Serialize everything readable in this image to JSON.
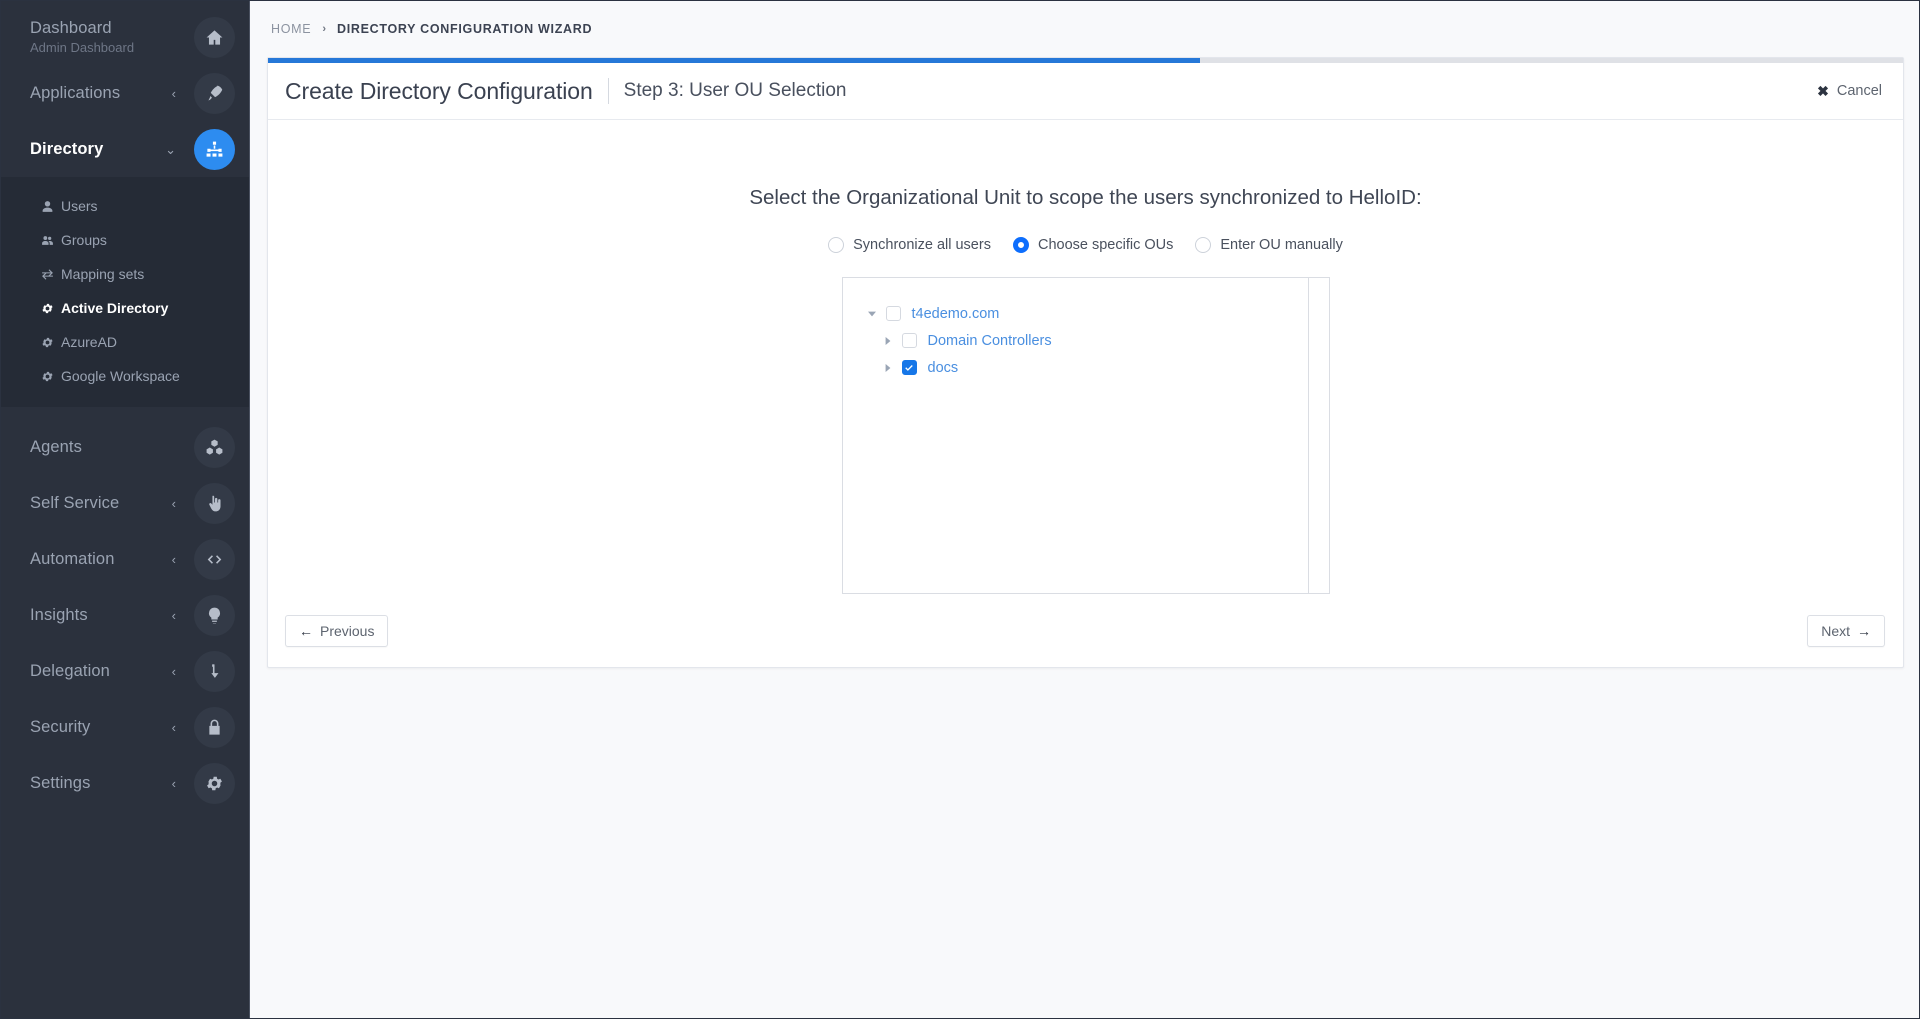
{
  "sidebar": {
    "top_items": [
      {
        "label": "Dashboard",
        "sublabel": "Admin Dashboard",
        "icon": "home-icon",
        "caret": "",
        "active": false
      },
      {
        "label": "Applications",
        "sublabel": "",
        "icon": "rocket-icon",
        "caret": "‹",
        "active": false
      },
      {
        "label": "Directory",
        "sublabel": "",
        "icon": "sitemap-icon",
        "caret": "⌄",
        "active": true
      }
    ],
    "sub_items": [
      {
        "label": "Users",
        "icon": "user-icon",
        "active": false
      },
      {
        "label": "Groups",
        "icon": "users-icon",
        "active": false
      },
      {
        "label": "Mapping sets",
        "icon": "exchange-icon",
        "active": false
      },
      {
        "label": "Active Directory",
        "icon": "gear-icon",
        "active": true
      },
      {
        "label": "AzureAD",
        "icon": "gear-icon",
        "active": false
      },
      {
        "label": "Google Workspace",
        "icon": "gear-icon",
        "active": false
      }
    ],
    "bottom_items": [
      {
        "label": "Agents",
        "sublabel": "",
        "icon": "cubes-icon",
        "caret": "",
        "active": false
      },
      {
        "label": "Self Service",
        "sublabel": "",
        "icon": "hand-pointer-icon",
        "caret": "‹",
        "active": false
      },
      {
        "label": "Automation",
        "sublabel": "",
        "icon": "code-icon",
        "caret": "‹",
        "active": false
      },
      {
        "label": "Insights",
        "sublabel": "",
        "icon": "lightbulb-icon",
        "caret": "‹",
        "active": false
      },
      {
        "label": "Delegation",
        "sublabel": "",
        "icon": "level-down-icon",
        "caret": "‹",
        "active": false
      },
      {
        "label": "Security",
        "sublabel": "",
        "icon": "lock-icon",
        "caret": "‹",
        "active": false
      },
      {
        "label": "Settings",
        "sublabel": "",
        "icon": "gear-icon",
        "caret": "‹",
        "active": false
      }
    ]
  },
  "breadcrumb": {
    "home": "HOME",
    "separator": "›",
    "current": "DIRECTORY CONFIGURATION WIZARD"
  },
  "wizard": {
    "progress_percent": 57,
    "title": "Create Directory Configuration",
    "subtitle": "Step 3: User OU Selection",
    "cancel_label": "Cancel",
    "cancel_icon": "✖",
    "prompt": "Select the Organizational Unit to scope the users synchronized to HelloID:",
    "options": [
      {
        "label": "Synchronize all users",
        "selected": false
      },
      {
        "label": "Choose specific OUs",
        "selected": true
      },
      {
        "label": "Enter OU manually",
        "selected": false
      }
    ],
    "tree": [
      {
        "label": "t4edemo.com",
        "depth": 0,
        "expanded": true,
        "checked": false,
        "arrow": "down"
      },
      {
        "label": "Domain Controllers",
        "depth": 1,
        "expanded": false,
        "checked": false,
        "arrow": "right"
      },
      {
        "label": "docs",
        "depth": 1,
        "expanded": false,
        "checked": true,
        "arrow": "right"
      }
    ],
    "previous_label": "Previous",
    "previous_icon": "←",
    "next_label": "Next",
    "next_icon": "→"
  },
  "colors": {
    "accent": "#2d8cf0",
    "progress": "#2678d8",
    "sidebar_bg": "#2b313d",
    "submenu_bg": "#252b36",
    "tree_link": "#4a8fe0",
    "checkbox_checked": "#1677e8"
  }
}
